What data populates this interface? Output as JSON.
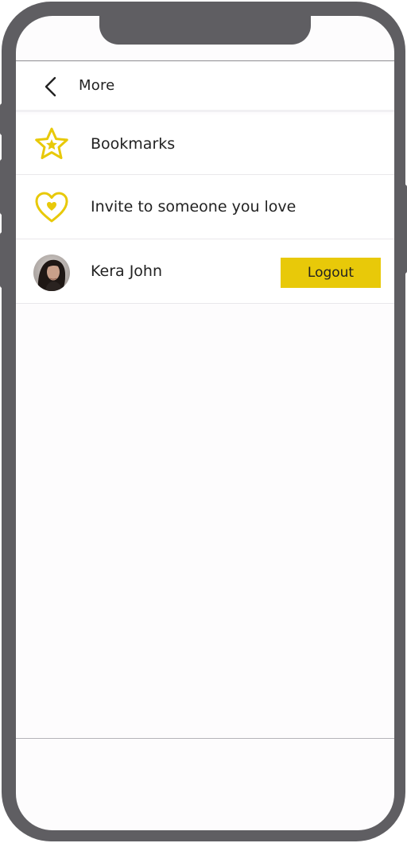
{
  "header": {
    "title": "More",
    "back_icon": "chevron-left-icon"
  },
  "menu": {
    "items": [
      {
        "label": "Bookmarks",
        "icon": "star-icon"
      },
      {
        "label": "Invite to someone you love",
        "icon": "heart-icon"
      }
    ]
  },
  "profile": {
    "name": "Kera John",
    "logout_label": "Logout"
  },
  "colors": {
    "accent": "#e8c909",
    "frame": "#5f5e62",
    "text": "#222222"
  }
}
